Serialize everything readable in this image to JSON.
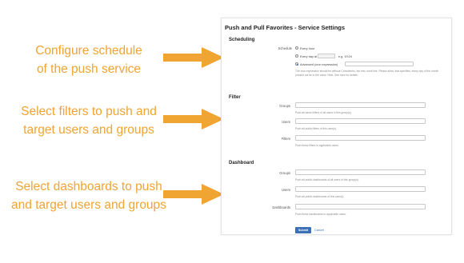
{
  "annotations": [
    {
      "line1": "Configure schedule",
      "line2": "of the push service"
    },
    {
      "line1": "Select filters to push and",
      "line2": "target users and groups"
    },
    {
      "line1": "Select dashboards to push",
      "line2": "and target users and groups"
    }
  ],
  "panel": {
    "title": "Push and Pull Favorites - Service Settings",
    "scheduling": {
      "heading": "Scheduling",
      "schedule_label": "Schedule",
      "options": [
        "Every hour",
        "Every day at",
        "Advanced (cron expression)"
      ],
      "selected_option": "Advanced (cron expression)",
      "time_example": "e.g. 19:24",
      "help_text": "The cron expression should be without Crowdtechs, but rest, work fine. Please allow, that specifies, every day of the month (should not be in the value.  Next. See here for details."
    },
    "filter": {
      "heading": "Filter",
      "groups_label": "Groups",
      "groups_help": "Push all saved filters of all users in this group(s).",
      "users_label": "Users",
      "users_help": "Push all public filters of this user(s).",
      "filters_label": "Filters",
      "filters_help": "Push these filters to applicable users."
    },
    "dashboard": {
      "heading": "Dashboard",
      "groups_label": "Groups",
      "groups_help": "Push all public dashboards of all users in this group(s).",
      "users_label": "Users",
      "users_help": "Push all public dashboards of this user(s).",
      "dashboards_label": "Dashboards",
      "dashboards_help": "Push these dashboards to applicable users."
    },
    "submit_label": "Submit",
    "cancel_label": "Cancel"
  },
  "colors": {
    "annotation": "#f0a431",
    "accent": "#3b6fb6"
  }
}
